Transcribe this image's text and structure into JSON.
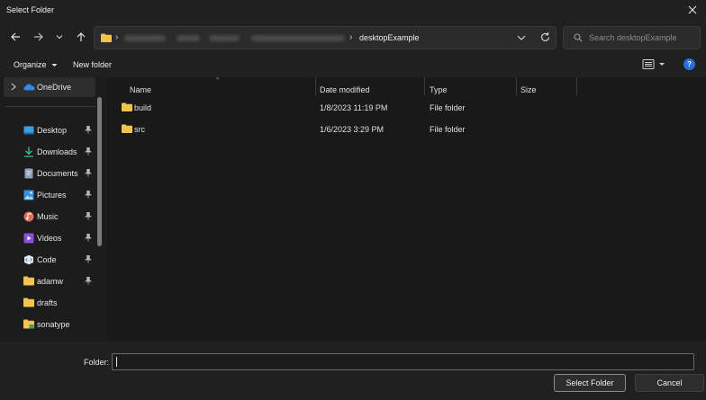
{
  "window": {
    "title": "Select Folder"
  },
  "nav": {
    "current_folder": "desktopExample",
    "search_placeholder": "Search desktopExample"
  },
  "toolbar": {
    "organize_label": "Organize",
    "new_folder_label": "New folder"
  },
  "sidebar": {
    "onedrive": "OneDrive",
    "items": [
      {
        "label": "Desktop",
        "icon": "desktop-icon",
        "pinned": true
      },
      {
        "label": "Downloads",
        "icon": "download-icon",
        "pinned": true
      },
      {
        "label": "Documents",
        "icon": "documents-icon",
        "pinned": true
      },
      {
        "label": "Pictures",
        "icon": "pictures-icon",
        "pinned": true
      },
      {
        "label": "Music",
        "icon": "music-icon",
        "pinned": true
      },
      {
        "label": "Videos",
        "icon": "videos-icon",
        "pinned": true
      },
      {
        "label": "Code",
        "icon": "code-icon",
        "pinned": true
      },
      {
        "label": "adamw",
        "icon": "folder-icon",
        "pinned": true
      },
      {
        "label": "drafts",
        "icon": "folder-icon",
        "pinned": false
      },
      {
        "label": "sonatype",
        "icon": "folder-icon",
        "pinned": false
      }
    ]
  },
  "columns": {
    "name": "Name",
    "date": "Date modified",
    "type": "Type",
    "size": "Size"
  },
  "files": [
    {
      "name": "build",
      "date": "1/8/2023 11:19 PM",
      "type": "File folder"
    },
    {
      "name": "src",
      "date": "1/6/2023 3:29 PM",
      "type": "File folder"
    }
  ],
  "footer": {
    "folder_label": "Folder:",
    "folder_value": "",
    "select_label": "Select Folder",
    "cancel_label": "Cancel"
  },
  "colors": {
    "accent": "#2b6fd6",
    "folder": "#f2c34e",
    "background": "#1c1c1c"
  }
}
